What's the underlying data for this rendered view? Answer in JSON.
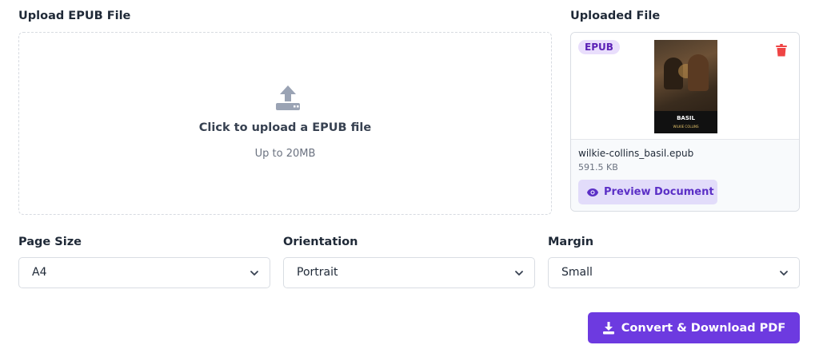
{
  "upload": {
    "title": "Upload EPUB File",
    "prompt": "Click to upload a EPUB file",
    "limit": "Up to 20MB",
    "icon": "upload-icon"
  },
  "uploaded": {
    "title": "Uploaded File",
    "badge": "EPUB",
    "cover_title": "BASIL",
    "cover_author": "WILKIE COLLINS",
    "file_name": "wilkie-collins_basil.epub",
    "file_size": "591.5 KB",
    "preview_label": "Preview Document",
    "delete_icon": "trash-icon"
  },
  "options": {
    "page_size": {
      "label": "Page Size",
      "value": "A4"
    },
    "orientation": {
      "label": "Orientation",
      "value": "Portrait"
    },
    "margin": {
      "label": "Margin",
      "value": "Small"
    }
  },
  "convert": {
    "label": "Convert & Download PDF",
    "icon": "download-icon"
  },
  "colors": {
    "accent": "#6d3ae0",
    "badge_bg": "#e9defc",
    "preview_bg": "#e2dcfa",
    "delete": "#ef4444"
  }
}
